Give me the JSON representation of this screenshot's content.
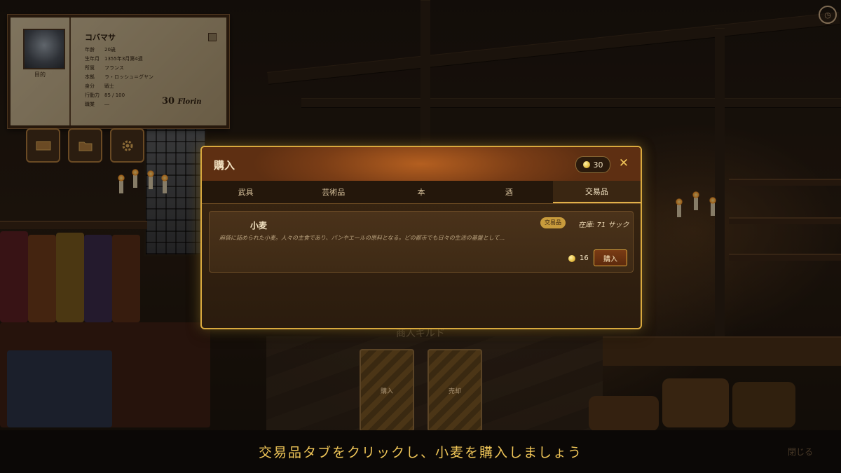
{
  "character": {
    "name": "コバマサ",
    "portrait_label": "目的",
    "rows": [
      {
        "k": "年齢",
        "v": "20歳"
      },
      {
        "k": "生年月",
        "v": "1355年3月第4週"
      },
      {
        "k": "所属",
        "v": "フランス"
      },
      {
        "k": "本拠",
        "v": "ラ・ロッシュ＝グヤン"
      },
      {
        "k": "身分",
        "v": "戦士"
      },
      {
        "k": "行動力",
        "v": "85 / 100"
      },
      {
        "k": "職業",
        "v": "―"
      }
    ],
    "money": "30",
    "money_unit": "Florin"
  },
  "hud": {
    "buttons": [
      "map-icon",
      "folder-icon",
      "gear-icon"
    ],
    "clock_icon": "clock-icon"
  },
  "guild": {
    "title": "商人ギルド",
    "buy_label": "購入",
    "sell_label": "売却"
  },
  "modal": {
    "title": "購入",
    "coins": "30",
    "close_glyph": "✕",
    "tabs": [
      "武具",
      "芸術品",
      "本",
      "酒",
      "交易品"
    ],
    "active_tab": 4,
    "items": [
      {
        "name": "小麦",
        "badge": "交易品",
        "stock": "在庫: 71 サック",
        "description": "麻袋に詰められた小麦。人々の主食であり、パンやエールの原料となる。どの都市でも日々の生活の基盤として…",
        "price": "16",
        "buy_label": "購入"
      }
    ]
  },
  "instruction": "交易品タブをクリックし、小麦を購入しましょう",
  "close_label": "閉じる",
  "colors": {
    "accent": "#d9a93e",
    "instruction": "#f0c658",
    "header": "#b45f20"
  }
}
